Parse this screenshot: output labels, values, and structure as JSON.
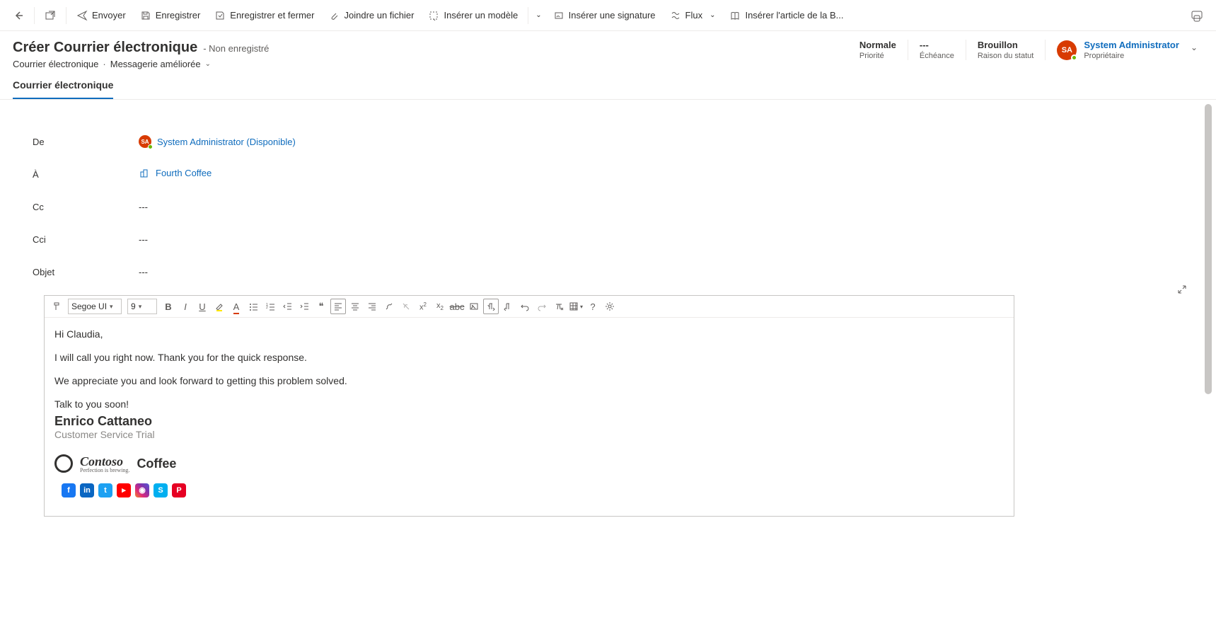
{
  "toolbar": {
    "send": "Envoyer",
    "save": "Enregistrer",
    "save_close": "Enregistrer et fermer",
    "attach": "Joindre un fichier",
    "insert_template": "Insérer un modèle",
    "insert_signature": "Insérer une signature",
    "flow": "Flux",
    "insert_article": "Insérer l'article de la B..."
  },
  "header": {
    "title": "Créer Courrier électronique",
    "status": "- Non enregistré",
    "breadcrumb_1": "Courrier électronique",
    "breadcrumb_2": "Messagerie améliorée",
    "priority_value": "Normale",
    "priority_label": "Priorité",
    "due_value": "---",
    "due_label": "Échéance",
    "reason_value": "Brouillon",
    "reason_label": "Raison du statut",
    "owner_initials": "SA",
    "owner_name": "System Administrator",
    "owner_role": "Propriétaire"
  },
  "tabs": {
    "tab1": "Courrier électronique"
  },
  "fields": {
    "from_label": "De",
    "from_value": "System Administrator (Disponible)",
    "from_initials": "SA",
    "to_label": "À",
    "to_value": "Fourth Coffee",
    "cc_label": "Cc",
    "cc_value": "---",
    "bcc_label": "Cci",
    "bcc_value": "---",
    "subject_label": "Objet",
    "subject_value": "---"
  },
  "editor": {
    "font_family": "Segoe UI",
    "font_size": "9",
    "body_p1": "Hi Claudia,",
    "body_p2": "I will call you right now. Thank you for the quick response.",
    "body_p3": "We appreciate you and look forward to getting this problem solved.",
    "body_p4": "Talk to you soon!",
    "sig_name": "Enrico Cattaneo",
    "sig_role": "Customer Service Trial",
    "logo_brand": "Contoso",
    "logo_tag": "Perfection is brewing.",
    "logo_coffee": "Coffee",
    "social": {
      "fb": "f",
      "li": "in",
      "tw": "t",
      "yt": "▸",
      "ig": "◉",
      "sk": "S",
      "pi": "P"
    }
  }
}
